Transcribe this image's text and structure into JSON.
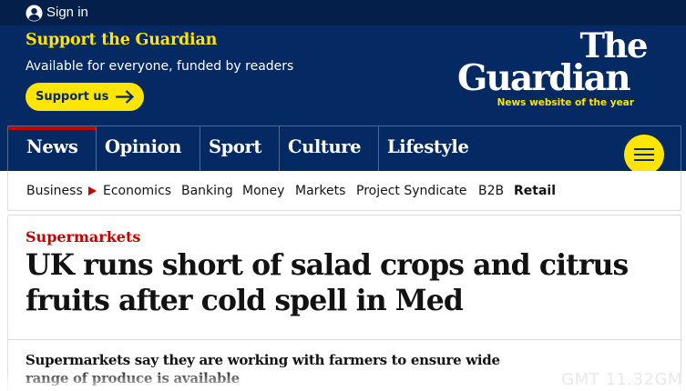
{
  "header": {
    "sign_in_label": "Sign in",
    "user_icon": "user-circle-icon"
  },
  "support": {
    "title": "Support the Guardian",
    "subtitle": "Available for everyone, funded by readers",
    "button_label": "Support us",
    "button_icon": "arrow-right-icon"
  },
  "logo": {
    "line1": "The",
    "line2": "Guardian",
    "tagline": "News website of the year"
  },
  "pillars": [
    {
      "label": "News",
      "active": true
    },
    {
      "label": "Opinion",
      "active": false
    },
    {
      "label": "Sport",
      "active": false
    },
    {
      "label": "Culture",
      "active": false
    },
    {
      "label": "Lifestyle",
      "active": false
    }
  ],
  "menu": {
    "icon": "hamburger-menu-icon"
  },
  "subnav": {
    "items": [
      "Business",
      "Economics",
      "Banking",
      "Money",
      "Markets",
      "Project Syndicate",
      "B2B",
      "Retail"
    ],
    "current": "Retail",
    "caret_icon": "caret-right-icon"
  },
  "article": {
    "kicker": "Supermarkets",
    "headline": "UK runs short of salad crops and citrus fruits after cold spell in Med",
    "standfirst": "Supermarkets say they are working with farmers to ensure wide range of produce is available",
    "timestamp_partial": "GMT 11.32GM"
  },
  "colors": {
    "brand_blue": "#052962",
    "top_bar": "#041f4a",
    "yellow": "#ffe500",
    "news_red": "#c70000",
    "divider": "#506991"
  }
}
